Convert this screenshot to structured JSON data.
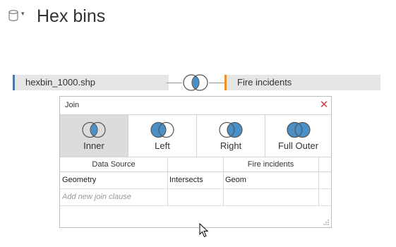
{
  "header": {
    "title": "Hex bins",
    "datasource_icon": "database-icon",
    "caret_icon": "caret-down-icon"
  },
  "canvas": {
    "left_table": "hexbin_1000.shp",
    "right_table": "Fire incidents",
    "left_accent": "#4e79a7",
    "right_accent": "#f28e2b",
    "join_icon": "inner-join-venn-icon"
  },
  "join_dialog": {
    "title": "Join",
    "close_icon": "close-icon",
    "join_types": [
      {
        "label": "Inner",
        "selected": true
      },
      {
        "label": "Left",
        "selected": false
      },
      {
        "label": "Right",
        "selected": false
      },
      {
        "label": "Full Outer",
        "selected": false
      }
    ],
    "columns": {
      "left": "Data Source",
      "right": "Fire incidents"
    },
    "clauses": [
      {
        "left_field": "Geometry",
        "operator": "Intersects",
        "right_field": "Geom"
      }
    ],
    "add_clause_placeholder": "Add new join clause",
    "venn_fill": "#4a90c8"
  }
}
